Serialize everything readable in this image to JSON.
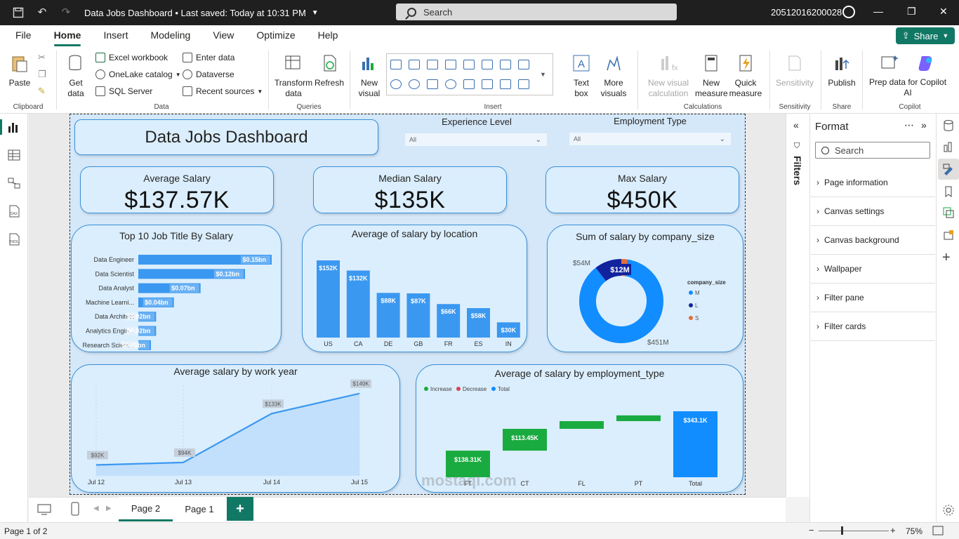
{
  "window": {
    "title": "Data Jobs Dashboard • Last saved: Today at 10:31 PM",
    "search_placeholder": "Search",
    "user": "20512016200028"
  },
  "menu": {
    "items": [
      "File",
      "Home",
      "Insert",
      "Modeling",
      "View",
      "Optimize",
      "Help"
    ],
    "share": "Share"
  },
  "ribbon": {
    "paste": "Paste",
    "clipboard": "Clipboard",
    "get_data": "Get data",
    "excel": "Excel workbook",
    "onelake": "OneLake catalog",
    "sql": "SQL Server",
    "enter_data": "Enter data",
    "dataverse": "Dataverse",
    "recent": "Recent sources",
    "data": "Data",
    "transform": "Transform data",
    "refresh": "Refresh",
    "queries": "Queries",
    "new_visual": "New visual",
    "text_box": "Text box",
    "more_visuals": "More visuals",
    "insert": "Insert",
    "new_visual_calc": "New visual calculation",
    "new_measure": "New measure",
    "quick_measure": "Quick measure",
    "calculations": "Calculations",
    "sensitivity_btn": "Sensitivity",
    "sensitivity": "Sensitivity",
    "publish": "Publish",
    "share_group": "Share",
    "prep": "Prep data for Copilot AI",
    "copilot": "Copilot"
  },
  "dashboard": {
    "title": "Data Jobs Dashboard",
    "slicers": [
      {
        "label": "Experience Level",
        "value": "All"
      },
      {
        "label": "Employment Type",
        "value": "All"
      }
    ],
    "kpis": [
      {
        "label": "Average Salary",
        "value": "$137.57K"
      },
      {
        "label": "Median Salary",
        "value": "$135K"
      },
      {
        "label": "Max Salary",
        "value": "$450K"
      }
    ]
  },
  "chart_data": [
    {
      "type": "bar",
      "orientation": "horizontal",
      "title": "Top 10 Job Title By Salary",
      "categories": [
        "Data Engineer",
        "Data Scientist",
        "Data Analyst",
        "Machine Learni...",
        "Data Architect",
        "Analytics Engin...",
        "Research Scient..."
      ],
      "values": [
        0.15,
        0.12,
        0.07,
        0.04,
        0.02,
        0.02,
        0.01
      ],
      "data_labels": [
        "$0.15bn",
        "$0.12bn",
        "$0.07bn",
        "$0.04bn",
        "$0.02bn",
        "$0.02bn",
        "$0.01bn"
      ],
      "color": "#3b98f0"
    },
    {
      "type": "bar",
      "title": "Average of salary by location",
      "categories": [
        "US",
        "CA",
        "DE",
        "GB",
        "FR",
        "ES",
        "IN"
      ],
      "values": [
        152,
        132,
        88,
        87,
        66,
        58,
        30
      ],
      "data_labels": [
        "$152K",
        "$132K",
        "$88K",
        "$87K",
        "$66K",
        "$58K",
        "$30K"
      ],
      "color": "#3b98f0"
    },
    {
      "type": "pie",
      "donut": true,
      "title": "Sum of salary by company_size",
      "legend_title": "company_size",
      "categories": [
        "M",
        "L",
        "S"
      ],
      "values": [
        451,
        54,
        12
      ],
      "data_labels": [
        "$451M",
        "$54M",
        "$12M"
      ],
      "colors": [
        "#118dff",
        "#12239e",
        "#e66c37"
      ]
    },
    {
      "type": "area",
      "title": "Average salary by work year",
      "categories": [
        "Jul 12",
        "Jul 13",
        "Jul 14",
        "Jul 15"
      ],
      "values": [
        92,
        94,
        133,
        149
      ],
      "data_labels": [
        "$92K",
        "$94K",
        "$133K",
        "$149K"
      ],
      "color": "#3b98f0"
    },
    {
      "type": "bar",
      "subtype": "waterfall",
      "title": "Average of salary by employment_type",
      "legend": [
        "Increase",
        "Decrease",
        "Total"
      ],
      "legend_colors": [
        "#1aab40",
        "#d64550",
        "#118dff"
      ],
      "categories": [
        "FT",
        "CT",
        "FL",
        "PT",
        "Total"
      ],
      "values": [
        138.31,
        113.45,
        40,
        30,
        343.1
      ],
      "data_labels": [
        "$138.31K",
        "$113.45K",
        "",
        "",
        "$343.1K"
      ]
    }
  ],
  "filters": {
    "label": "Filters"
  },
  "format_pane": {
    "title": "Format",
    "search": "Search",
    "items": [
      "Page information",
      "Canvas settings",
      "Canvas background",
      "Wallpaper",
      "Filter pane",
      "Filter cards"
    ]
  },
  "pages": {
    "tabs": [
      "Page 2",
      "Page 1"
    ],
    "add": "+"
  },
  "status": {
    "page": "Page 1 of 2",
    "zoom": "75%"
  },
  "watermark": {
    "text": "mostaql.com"
  }
}
